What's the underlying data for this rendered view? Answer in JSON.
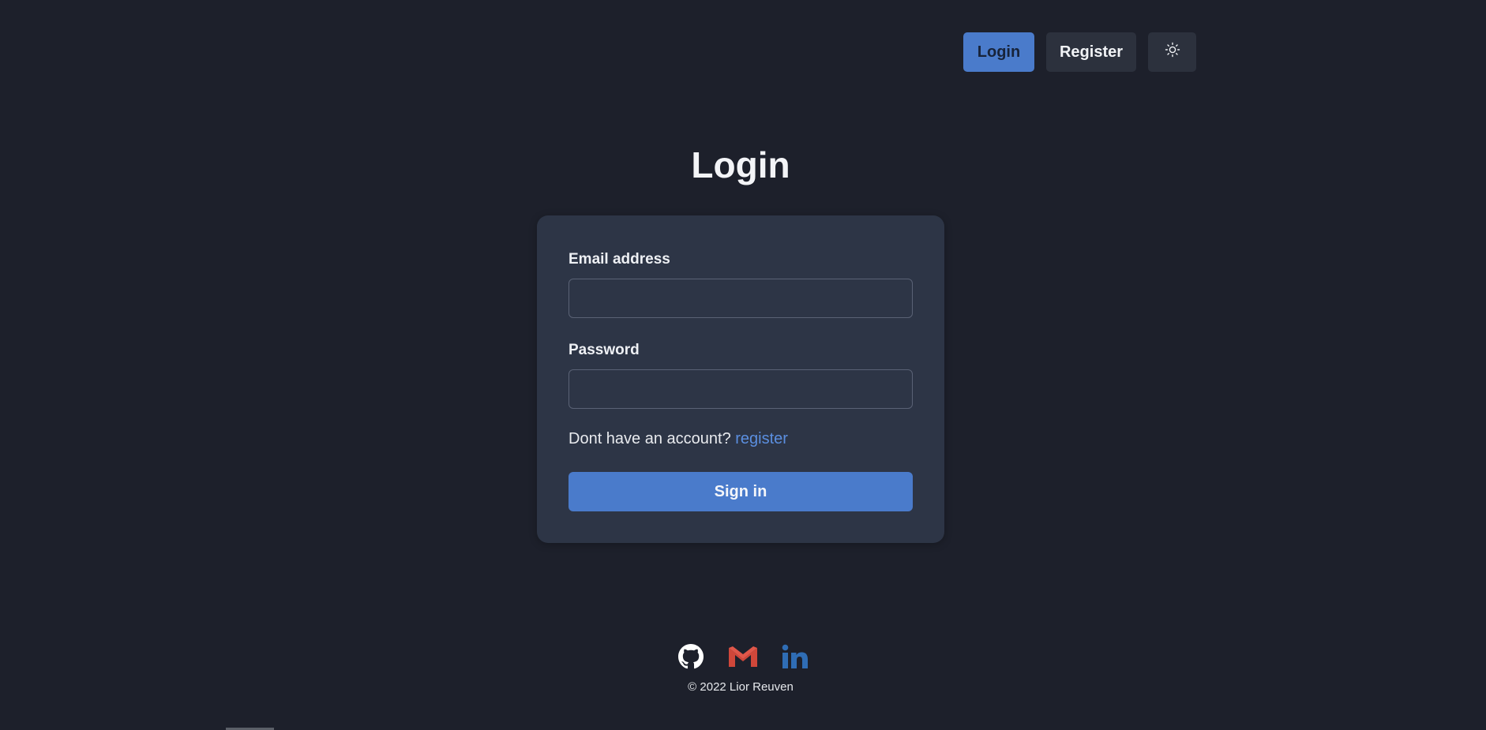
{
  "nav": {
    "login_label": "Login",
    "register_label": "Register",
    "theme_icon": "sun-icon"
  },
  "main": {
    "title": "Login",
    "email_label": "Email address",
    "email_value": "",
    "password_label": "Password",
    "password_value": "",
    "hint_text": "Dont have an account?",
    "register_link": "register",
    "signin_label": "Sign in"
  },
  "footer": {
    "icons": [
      "github-icon",
      "gmail-icon",
      "linkedin-icon"
    ],
    "copyright": "© 2022 Lior Reuven"
  },
  "colors": {
    "background": "#1d202b",
    "card": "#2d3546",
    "accent": "#4a7bcb",
    "link": "#5b8fe0",
    "gmail": "#d0473a",
    "linkedin": "#2f6db5"
  }
}
